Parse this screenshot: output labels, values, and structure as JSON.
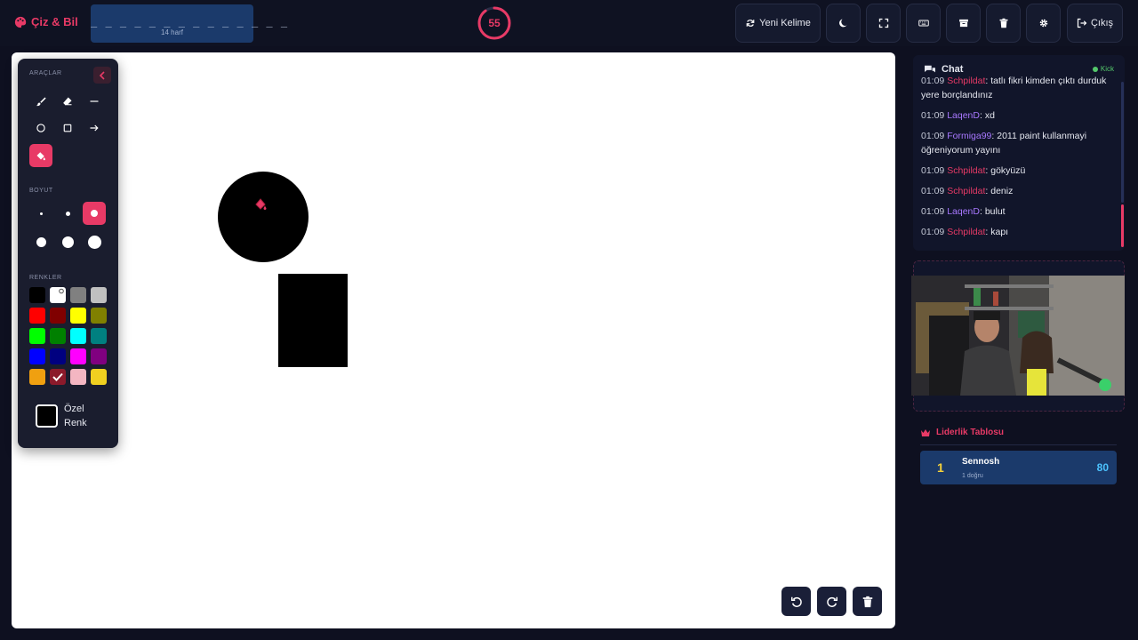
{
  "app": {
    "name": "Çiz & Bil",
    "brand_color": "#e83a66"
  },
  "word": {
    "dashes": "_ _ _ _ _ _ _ _ _ _ _ _ _ _",
    "letters": "14 harf"
  },
  "timer": {
    "value": "55",
    "progress": 0.9
  },
  "toolbar": {
    "new_word": "Yeni Kelime",
    "exit": "Çıkış",
    "icons": [
      "moon-icon",
      "fullscreen-icon",
      "keyboard-icon",
      "archive-icon",
      "trash-icon",
      "gear-icon"
    ]
  },
  "tools_panel": {
    "tools_title": "ARAÇLAR",
    "size_title": "BOYUT",
    "colors_title": "RENKLER",
    "custom_color_label": "Özel Renk",
    "active_tool": "fill",
    "active_size": 3,
    "selected_color": "#8b1a2b",
    "colors": [
      "#000000",
      "#ffffff",
      "#808080",
      "#c0c0c0",
      "#ff0000",
      "#800000",
      "#ffff00",
      "#808000",
      "#00ff00",
      "#008000",
      "#00ffff",
      "#008080",
      "#0000ff",
      "#000080",
      "#ff00ff",
      "#800080",
      "#f0a010",
      "#8b1a2b",
      "#f4b6c2",
      "#f0d020"
    ]
  },
  "chat": {
    "title": "Chat",
    "status": "Kick",
    "messages": [
      {
        "time": "01:09",
        "user": "Schpildat",
        "user_color": "#e83a66",
        "text": ": tatlı fikri kimden çıktı durduk yere borçlandınız"
      },
      {
        "time": "01:09",
        "user": "LaqenD",
        "user_color": "#a878ff",
        "text": ": xd"
      },
      {
        "time": "01:09",
        "user": "Formiga99",
        "user_color": "#a878ff",
        "text": ": 2011 paint kullanmayi öğreniyorum yayını"
      },
      {
        "time": "01:09",
        "user": "Schpildat",
        "user_color": "#e83a66",
        "text": ": gökyüzü"
      },
      {
        "time": "01:09",
        "user": "Schpildat",
        "user_color": "#e83a66",
        "text": ": deniz"
      },
      {
        "time": "01:09",
        "user": "LaqenD",
        "user_color": "#a878ff",
        "text": ": bulut"
      },
      {
        "time": "01:09",
        "user": "Schpildat",
        "user_color": "#e83a66",
        "text": ": kapı"
      }
    ]
  },
  "leaderboard": {
    "title": "Liderlik Tablosu",
    "entries": [
      {
        "rank": "1",
        "name": "Sennosh",
        "sub": "1 doğru",
        "score": "80"
      }
    ]
  }
}
